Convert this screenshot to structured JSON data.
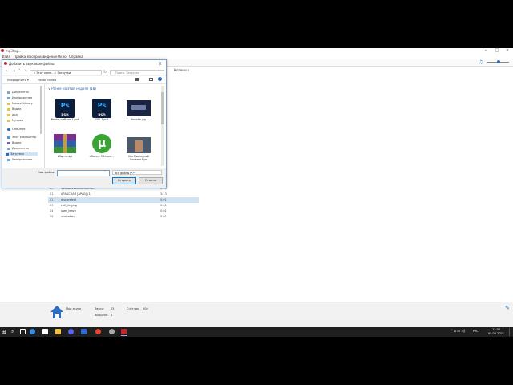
{
  "app": {
    "title": "mp3tag…",
    "menu": [
      "Файл",
      "Правка",
      "Воспроизведение",
      "Окно",
      "Справка"
    ],
    "column_keys": "Клавиша",
    "rows": [
      {
        "n": "20",
        "name": "144a8d410038e40038…",
        "len": "0:18"
      },
      {
        "n": "21",
        "name": "АРАБСКАЯ [АРАБ] (1)",
        "len": "3:13"
      },
      {
        "n": "22",
        "name": "discoreject",
        "len": "0:01",
        "selected": true
      },
      {
        "n": "23",
        "name": "call_ringing",
        "len": "0:01"
      },
      {
        "n": "24",
        "name": "user_leave",
        "len": "0:01"
      },
      {
        "n": "25",
        "name": "undeafen",
        "len": "0:01"
      }
    ],
    "status": {
      "library": "Мои звуки",
      "sounds_label": "Звуки:",
      "sounds_value": "25",
      "selected_label": "Выбрано:",
      "selected_value": "1",
      "counter_label": "Счётчик:",
      "counter_value": "300"
    }
  },
  "dialog": {
    "title": "Добавить звуковые файлы",
    "breadcrumb": "» Этот комп… ›  Загрузки",
    "search_placeholder": "Поиск: Загрузки",
    "organize": "Упорядочить ▾",
    "new_folder": "Новая папка",
    "sidebar": [
      "Документы",
      "Изображения",
      "Movavi Library",
      "Видео",
      "ауд",
      "Музыка",
      "OneDrive",
      "Этот компьютер",
      "Видео",
      "Документы",
      "Загрузки",
      "Изображения"
    ],
    "group_header": "∨ Ранее на этой неделе (18)",
    "files": [
      {
        "label": "белый шаблон 1.psd",
        "kind": "psd"
      },
      {
        "label": "000-7.psd",
        "kind": "psd"
      },
      {
        "label": "fortnite.jpg",
        "kind": "image"
      },
      {
        "label": "bflsp-nc.api",
        "kind": "archive"
      },
      {
        "label": "uTorrent 3D.store…",
        "kind": "torrent"
      },
      {
        "label": "Как Последний Отчитал Русс",
        "kind": "video"
      }
    ],
    "filename_label": "Имя файла:",
    "filename_value": "",
    "filetype": "Все файлы (*.*)",
    "open": "Открыть",
    "cancel": "Отмена"
  },
  "taskbar": {
    "lang": "РУС",
    "time": "11:06",
    "date": "05.06.2021"
  },
  "colors": {
    "accent": "#2b6cc4",
    "selection": "#cfe3f3",
    "ps_bg": "#0b1e3b",
    "ps_text": "#31a8ff"
  }
}
